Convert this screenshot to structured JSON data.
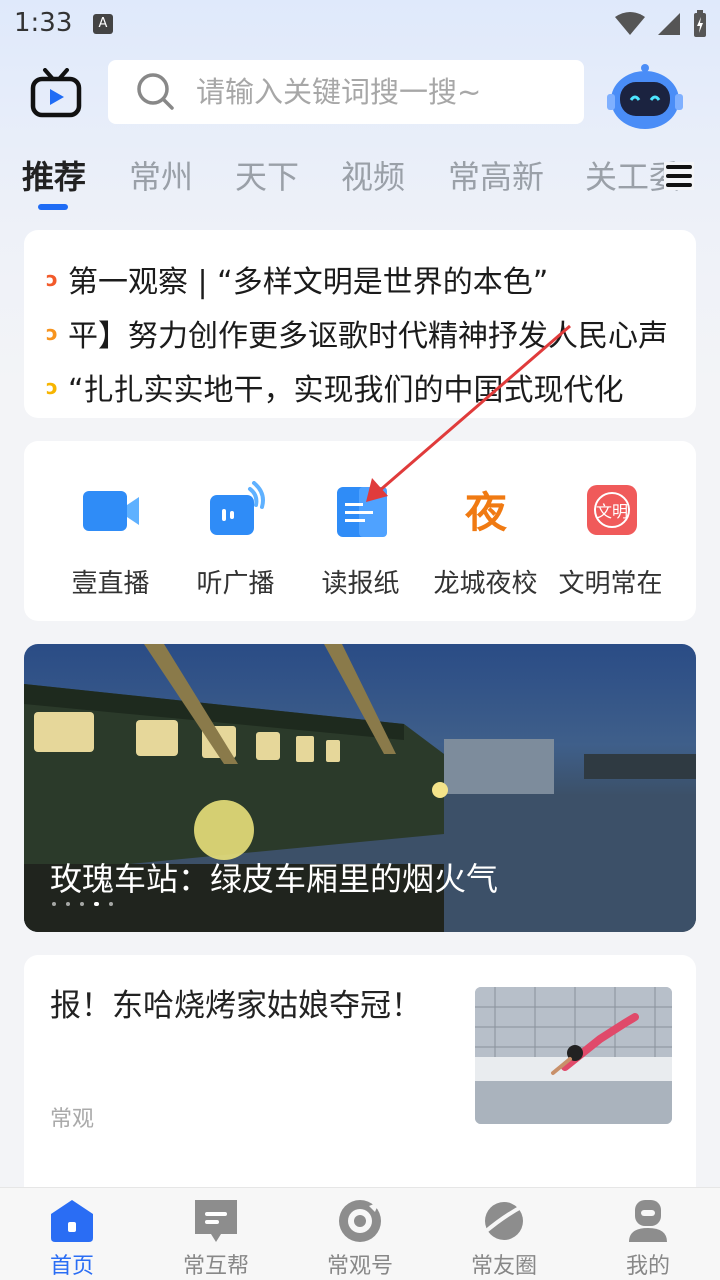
{
  "status_bar": {
    "time": "1:33",
    "indicator": "A"
  },
  "header": {
    "search_placeholder": "请输入关键词搜一搜~"
  },
  "tabs": [
    {
      "label": "推荐",
      "active": true
    },
    {
      "label": "常州"
    },
    {
      "label": "天下"
    },
    {
      "label": "视频"
    },
    {
      "label": "常高新"
    },
    {
      "label": "关工委"
    }
  ],
  "headlines": [
    {
      "text": "第一观察 | “多样文明是世界的本色”",
      "dot_color": "#f25a2a"
    },
    {
      "text": "平】努力创作更多讴歌时代精神抒发人民心声",
      "dot_color": "#f7941e"
    },
    {
      "text": "“扎扎实实地干，实现我们的中国式现代化",
      "dot_color": "#f7b500"
    }
  ],
  "quick_links": [
    {
      "label": "壹直播",
      "icon": "video-camera-icon"
    },
    {
      "label": "听广播",
      "icon": "radio-broadcast-icon"
    },
    {
      "label": "读报纸",
      "icon": "newspaper-icon"
    },
    {
      "label": "龙城夜校",
      "icon": "night-school-icon"
    },
    {
      "label": "文明常在",
      "icon": "civilization-icon"
    }
  ],
  "banner": {
    "caption": "玫瑰车站：绿皮车厢里的烟火气",
    "slide_count": 5,
    "active_slide": 4
  },
  "news": [
    {
      "title": "报！东哈烧烤家姑娘夺冠！",
      "source": "常观"
    }
  ],
  "bottom_nav": [
    {
      "label": "首页",
      "icon": "home-icon",
      "active": true
    },
    {
      "label": "常互帮",
      "icon": "help-chat-icon"
    },
    {
      "label": "常观号",
      "icon": "channel-icon"
    },
    {
      "label": "常友圈",
      "icon": "planet-icon"
    },
    {
      "label": "我的",
      "icon": "profile-icon"
    }
  ],
  "colors": {
    "accent": "#1f6cf5",
    "nav_active": "#2a6df4",
    "annotation_arrow": "#e03b3b"
  }
}
